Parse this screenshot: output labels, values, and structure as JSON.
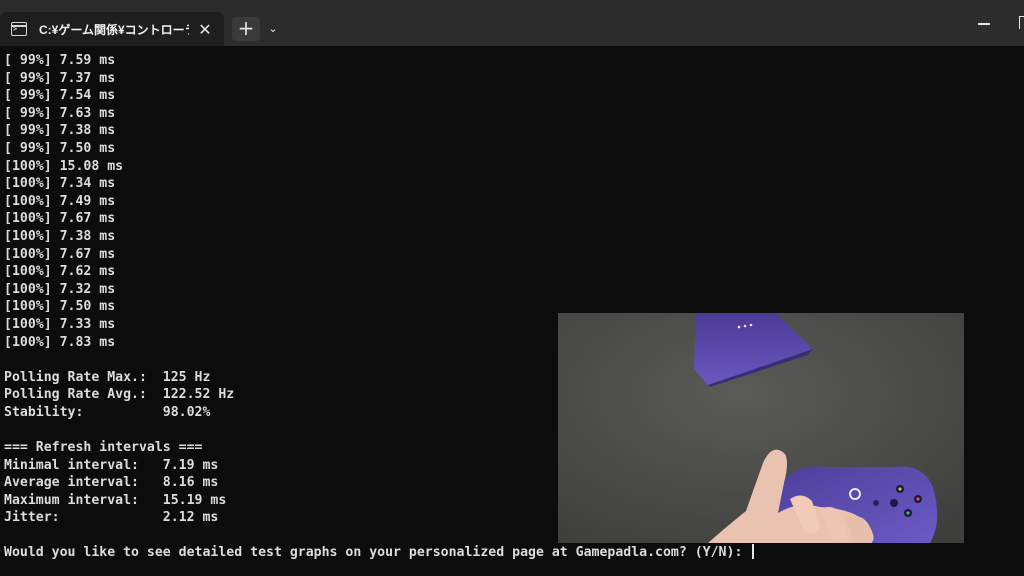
{
  "window": {
    "tab_title": "C:¥ゲーム関係¥コントローラー関係¥",
    "tab_close_glyph": "✕",
    "new_tab_glyph": "+",
    "dropdown_glyph": "⌄"
  },
  "terminal": {
    "lines": [
      "[ 99%] 7.59 ms",
      "[ 99%] 7.37 ms",
      "[ 99%] 7.54 ms",
      "[ 99%] 7.63 ms",
      "[ 99%] 7.38 ms",
      "[ 99%] 7.50 ms",
      "[100%] 15.08 ms",
      "[100%] 7.34 ms",
      "[100%] 7.49 ms",
      "[100%] 7.67 ms",
      "[100%] 7.38 ms",
      "[100%] 7.67 ms",
      "[100%] 7.62 ms",
      "[100%] 7.32 ms",
      "[100%] 7.50 ms",
      "[100%] 7.33 ms",
      "[100%] 7.83 ms",
      "",
      "Polling Rate Max.:  125 Hz",
      "Polling Rate Avg.:  122.52 Hz",
      "Stability:          98.02%",
      "",
      "=== Refresh intervals ===",
      "Minimal interval:   7.19 ms",
      "Average interval:   8.16 ms",
      "Maximum interval:   15.19 ms",
      "Jitter:             2.12 ms"
    ],
    "prompt": "Would you like to see detailed test graphs on your personalized page at Gamepadla.com? (Y/N): "
  },
  "overlay": {
    "kind": "webcam-feed",
    "background_color": "#4a4a48",
    "controller_color": "#5b4aa6"
  }
}
